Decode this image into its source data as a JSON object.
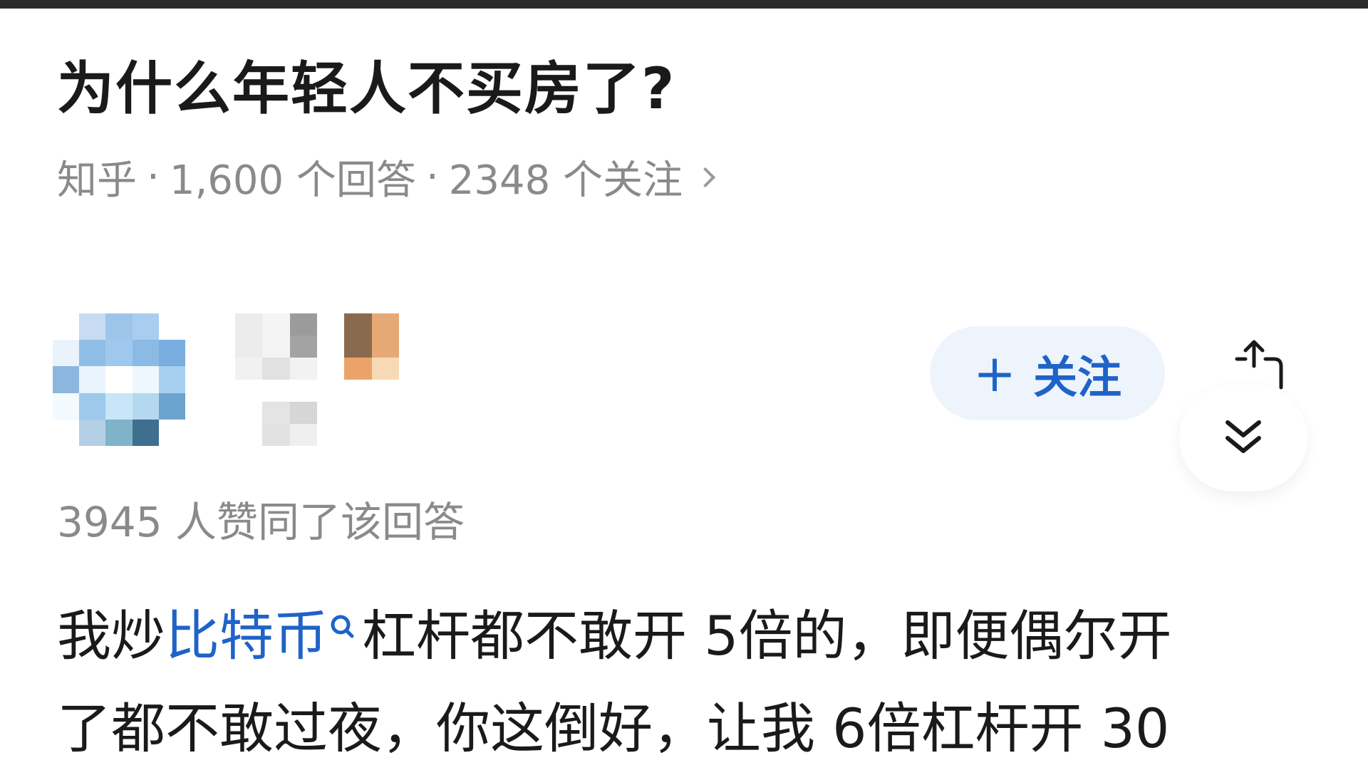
{
  "question": {
    "title": "为什么年轻人不买房了?",
    "source": "知乎",
    "separator": "·",
    "answers_count": "1,600 个回答",
    "followers_count": "2348 个关注"
  },
  "author": {
    "follow_label": "关注",
    "follow_plus": "+"
  },
  "answer": {
    "upvote_text": "3945 人赞同了该回答",
    "line1_prefix": "我炒",
    "line1_link": "比特币",
    "line1_suffix": "杠杆都不敢开 5倍的，即便偶尔开",
    "line2": "了都不敢过夜，你这倒好，让我 6倍杠杆开 30"
  },
  "colors": {
    "accent": "#1f63c7",
    "muted": "#8a8a8a",
    "title": "#1a1a1a",
    "follow_bg": "#eef4fc"
  },
  "icons": [
    "share-icon",
    "collapse-chevrons-icon",
    "search-icon",
    "chevron-right-icon",
    "plus-icon"
  ]
}
